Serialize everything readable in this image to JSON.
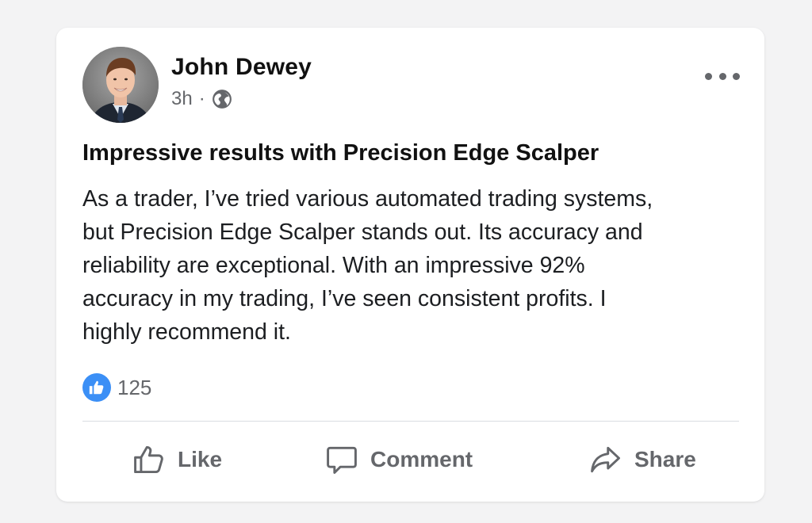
{
  "post": {
    "author": "John Dewey",
    "time": "3h",
    "separator": "·",
    "privacy_icon": "globe-icon",
    "more_icon": "ellipsis-icon",
    "title": "Impressive results with Precision Edge Scalper",
    "body": "As a trader, I’ve tried various automated trading systems, but Precision Edge Scalper stands out. Its accuracy and reliability are exceptional. With an impressive 92% accuracy in my trading, I’ve seen consistent profits. I highly recommend it.",
    "reactions": {
      "icon": "thumbs-up-icon",
      "count": "125",
      "badge_color": "#3b8ff6"
    },
    "actions": {
      "like": "Like",
      "comment": "Comment",
      "share": "Share"
    }
  },
  "colors": {
    "background": "#f3f3f4",
    "card": "#ffffff",
    "text_primary": "#111111",
    "text_secondary": "#65676b",
    "divider": "#dadde1"
  }
}
